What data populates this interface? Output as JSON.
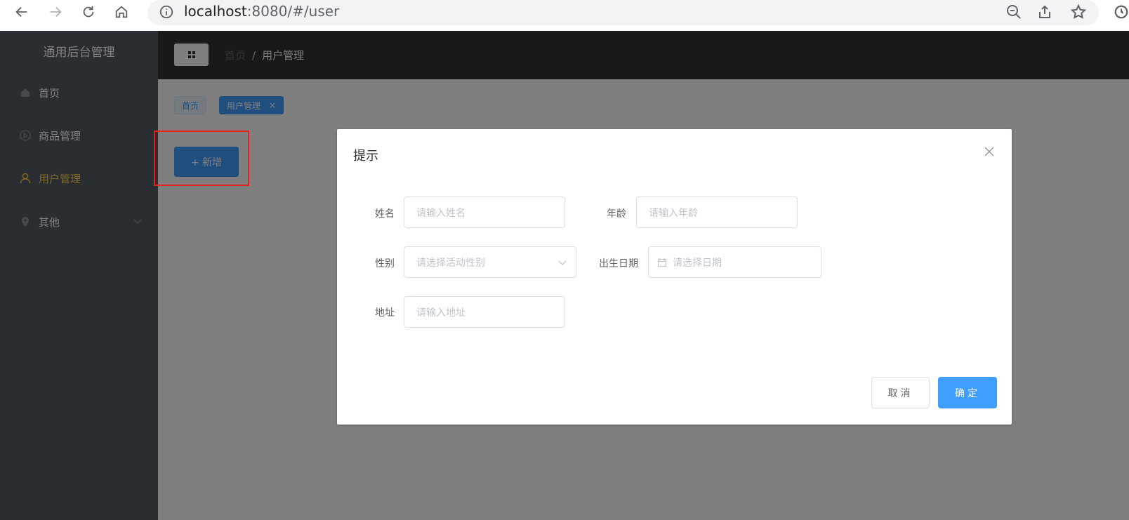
{
  "browser": {
    "url_host": "localhost",
    "url_rest": ":8080/#/user"
  },
  "sidebar": {
    "title": "通用后台管理",
    "items": [
      {
        "label": "首页",
        "icon": "home-icon"
      },
      {
        "label": "商品管理",
        "icon": "video-play-icon"
      },
      {
        "label": "用户管理",
        "icon": "user-icon",
        "active": true
      },
      {
        "label": "其他",
        "icon": "location-icon",
        "has_submenu": true
      }
    ]
  },
  "header": {
    "breadcrumb": {
      "home": "首页",
      "separator": "/",
      "current": "用户管理"
    }
  },
  "tags": [
    {
      "label": "首页"
    },
    {
      "label": "用户管理",
      "closable_glyph": "×"
    }
  ],
  "main": {
    "add_button": "+ 新增"
  },
  "dialog": {
    "title": "提示",
    "fields": {
      "name": {
        "label": "姓名",
        "placeholder": "请输入姓名"
      },
      "age": {
        "label": "年龄",
        "placeholder": "请输入年龄"
      },
      "sex": {
        "label": "性别",
        "placeholder": "请选择活动性别"
      },
      "birth": {
        "label": "出生日期",
        "placeholder": "请选择日期"
      },
      "addr": {
        "label": "地址",
        "placeholder": "请输入地址"
      }
    },
    "cancel": "取消",
    "confirm": "确定"
  },
  "colors": {
    "primary": "#409eff",
    "sidebar_bg": "#545c64",
    "active_menu": "#ffd04b",
    "highlight": "#e5231b"
  }
}
